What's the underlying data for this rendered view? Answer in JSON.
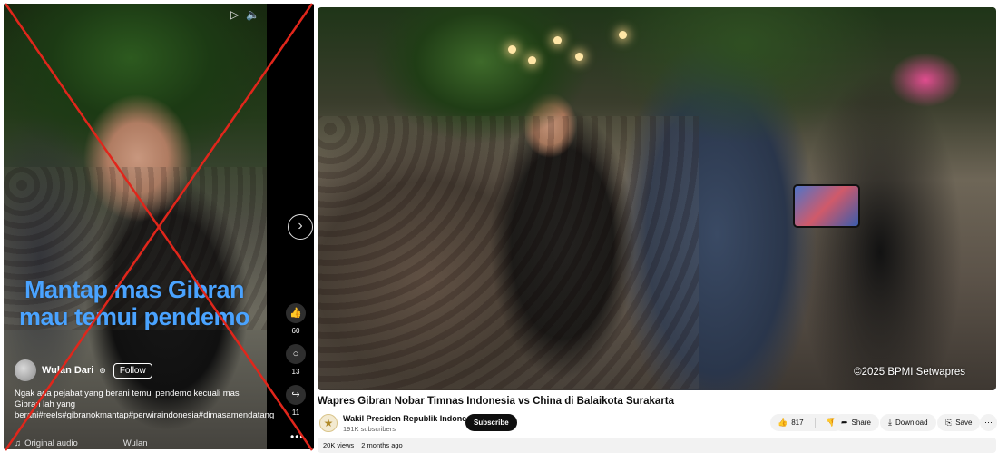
{
  "reel": {
    "caption_overlay": "Mantap mas Gibran mau temui pendemo",
    "author_name": "Wulan Dari",
    "follow_label": "Follow",
    "description": "Ngak ada pejabat yang berani temui pendemo kecuali mas Gibran lah yang berani#reels#gibranokmantap#perwiraindonesia#dimasamendatang",
    "audio_label": "Original audio",
    "audio_author": "Wulan",
    "like_count": "60",
    "comment_count": "13",
    "share_count": "11",
    "next_glyph": "›",
    "more_glyph": "•••",
    "icons": [
      "play-icon",
      "mute-icon",
      "like-icon",
      "comment-icon",
      "share-icon",
      "next-icon",
      "audio-icon"
    ]
  },
  "video": {
    "watermark": "©2025 BPMI Setwapres",
    "title": "Wapres Gibran Nobar Timnas Indonesia vs China di Balaikota Surakarta",
    "channel_name": "Wakil Presiden Republik Indonesia",
    "subscribers": "191K subscribers",
    "subscribe_label": "Subscribe",
    "like_count": "817",
    "share_label": "Share",
    "download_label": "Download",
    "save_label": "Save",
    "views": "20K views",
    "age": "2 months ago"
  },
  "colors": {
    "overlay_text": "#4aa3ff",
    "cross_line": "#e0261b",
    "subscribe_bg": "#0f0f0f"
  }
}
